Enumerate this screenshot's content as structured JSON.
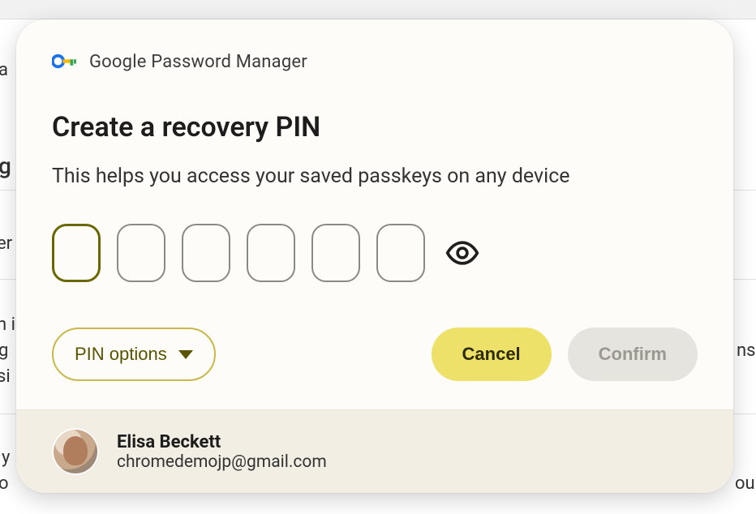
{
  "bg": {
    "frag1": "a",
    "frag2": "g",
    "frag3": "er",
    "frag4": "n i",
    "frag5": "g",
    "frag6": "si",
    "frag7": "ns",
    "frag8": "y",
    "frag9": "o",
    "frag10": "ou"
  },
  "header": {
    "product_label": "Google Password Manager"
  },
  "dialog": {
    "title": "Create a recovery PIN",
    "subtitle": "This helps you access your saved passkeys on any device",
    "pin_length": 6,
    "pin_options_label": "PIN options",
    "cancel_label": "Cancel",
    "confirm_label": "Confirm",
    "confirm_disabled": true
  },
  "user": {
    "name": "Elisa Beckett",
    "email": "chromedemojp@gmail.com"
  },
  "icons": {
    "product": "google-password-manager-icon",
    "visibility": "eye-icon",
    "dropdown": "chevron-down-icon",
    "avatar": "user-avatar"
  }
}
